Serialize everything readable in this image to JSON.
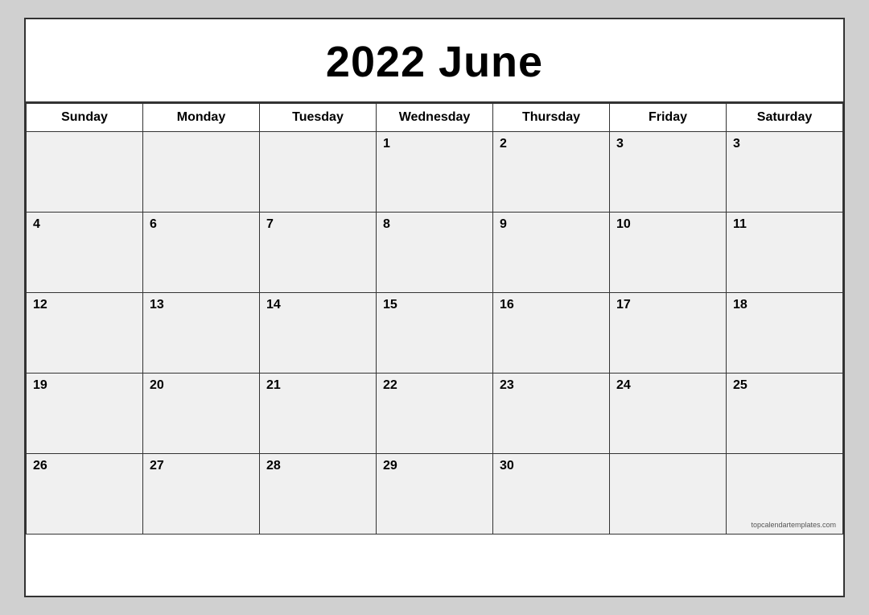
{
  "calendar": {
    "year": "2022",
    "month": "June",
    "title": "2022 June",
    "watermark": "topcalendartemplates.com",
    "days_of_week": [
      {
        "label": "Sunday"
      },
      {
        "label": "Monday"
      },
      {
        "label": "Tuesday"
      },
      {
        "label": "Wednesday"
      },
      {
        "label": "Thursday"
      },
      {
        "label": "Friday"
      },
      {
        "label": "Saturday"
      }
    ],
    "weeks": [
      [
        {
          "day": "",
          "empty": true
        },
        {
          "day": "",
          "empty": true
        },
        {
          "day": "",
          "empty": true
        },
        {
          "day": "1",
          "empty": false
        },
        {
          "day": "2",
          "empty": false
        },
        {
          "day": "3",
          "empty": false
        },
        {
          "day": "3",
          "empty": false
        }
      ],
      [
        {
          "day": "4",
          "empty": false
        },
        {
          "day": "6",
          "empty": false
        },
        {
          "day": "7",
          "empty": false
        },
        {
          "day": "8",
          "empty": false
        },
        {
          "day": "9",
          "empty": false
        },
        {
          "day": "10",
          "empty": false
        },
        {
          "day": "11",
          "empty": false
        }
      ],
      [
        {
          "day": "12",
          "empty": false
        },
        {
          "day": "13",
          "empty": false
        },
        {
          "day": "14",
          "empty": false
        },
        {
          "day": "15",
          "empty": false
        },
        {
          "day": "16",
          "empty": false
        },
        {
          "day": "17",
          "empty": false
        },
        {
          "day": "18",
          "empty": false
        }
      ],
      [
        {
          "day": "19",
          "empty": false
        },
        {
          "day": "20",
          "empty": false
        },
        {
          "day": "21",
          "empty": false
        },
        {
          "day": "22",
          "empty": false
        },
        {
          "day": "23",
          "empty": false
        },
        {
          "day": "24",
          "empty": false
        },
        {
          "day": "25",
          "empty": false
        }
      ],
      [
        {
          "day": "26",
          "empty": false
        },
        {
          "day": "27",
          "empty": false
        },
        {
          "day": "28",
          "empty": false
        },
        {
          "day": "29",
          "empty": false
        },
        {
          "day": "30",
          "empty": false
        },
        {
          "day": "",
          "empty": true
        },
        {
          "day": "",
          "empty": true,
          "has_watermark": true
        }
      ]
    ]
  }
}
